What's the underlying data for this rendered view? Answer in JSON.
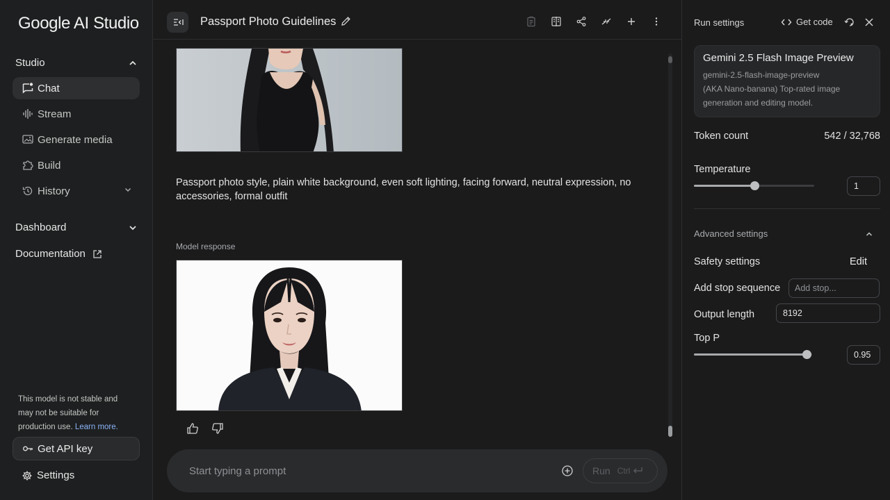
{
  "app": {
    "logo": "Google AI Studio"
  },
  "sidebar": {
    "studio_label": "Studio",
    "items": [
      {
        "label": "Chat",
        "icon": "chat-icon",
        "active": true
      },
      {
        "label": "Stream",
        "icon": "waveform-icon"
      },
      {
        "label": "Generate media",
        "icon": "image-icon"
      },
      {
        "label": "Build",
        "icon": "puzzle-icon"
      },
      {
        "label": "History",
        "icon": "history-icon"
      }
    ],
    "dashboard_label": "Dashboard",
    "documentation_label": "Documentation",
    "notice_text": "This model is not stable and may not be suitable for production use.",
    "notice_link": "Learn more.",
    "api_key_label": "Get API key",
    "settings_label": "Settings"
  },
  "header": {
    "title": "Passport Photo Guidelines"
  },
  "chat": {
    "user_prompt": "Passport photo style, plain white background, even soft lighting, facing forward, neutral expression, no accessories, formal outfit",
    "model_label": "Model response"
  },
  "prompt_bar": {
    "placeholder": "Start typing a prompt",
    "run_label": "Run",
    "shortcut": "Ctrl"
  },
  "run_settings": {
    "title": "Run settings",
    "get_code_label": "Get code",
    "model": {
      "name": "Gemini 2.5 Flash Image Preview",
      "id": "gemini-2.5-flash-image-preview",
      "description": "(AKA Nano-banana) Top-rated image generation and editing model."
    },
    "token_count_label": "Token count",
    "token_count_value": "542 / 32,768",
    "temperature_label": "Temperature",
    "temperature_value": "1",
    "temperature_fraction": 0.5,
    "advanced_label": "Advanced settings",
    "safety_label": "Safety settings",
    "safety_edit": "Edit",
    "stop_sequence_label": "Add stop sequence",
    "stop_sequence_placeholder": "Add stop...",
    "output_length_label": "Output length",
    "output_length_value": "8192",
    "top_p_label": "Top P",
    "top_p_value": "0.95",
    "top_p_fraction": 0.95
  }
}
